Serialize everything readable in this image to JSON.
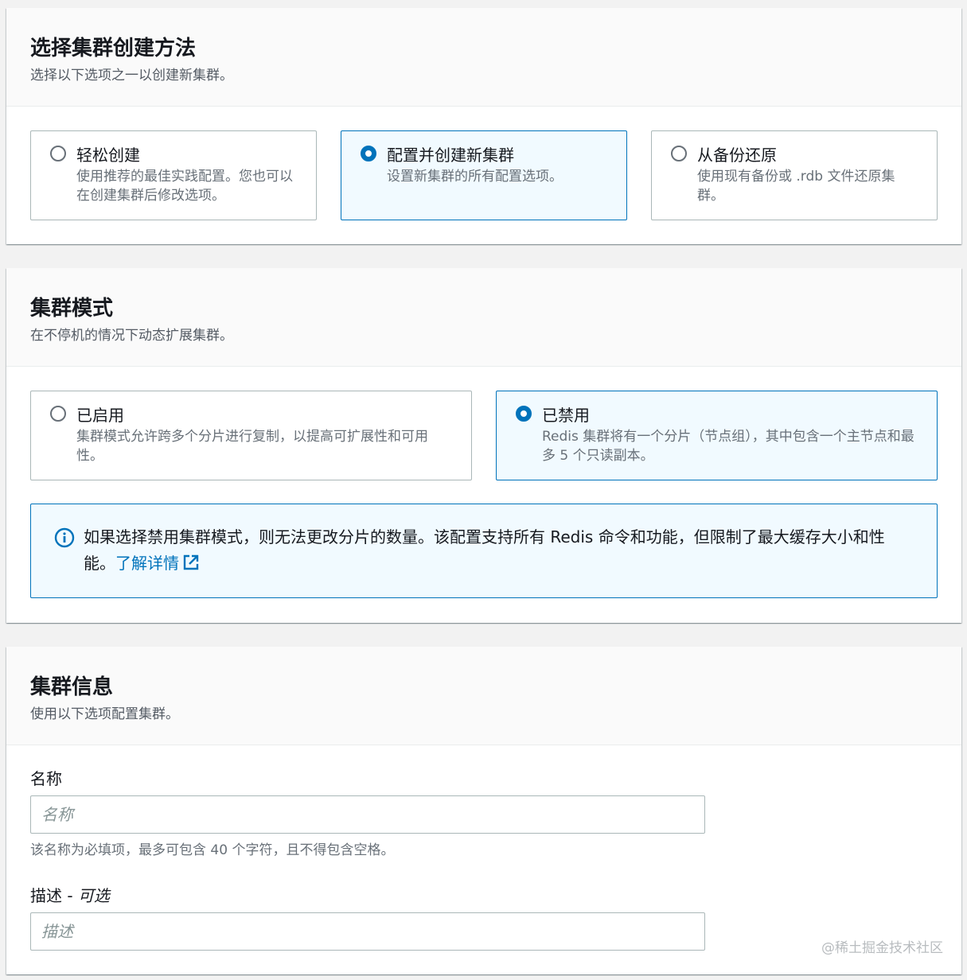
{
  "method_section": {
    "title": "选择集群创建方法",
    "description": "选择以下选项之一以创建新集群。",
    "options": [
      {
        "title": "轻松创建",
        "description": "使用推荐的最佳实践配置。您也可以在创建集群后修改选项。",
        "selected": false
      },
      {
        "title": "配置并创建新集群",
        "description": "设置新集群的所有配置选项。",
        "selected": true
      },
      {
        "title": "从备份还原",
        "description": "使用现有备份或 .rdb 文件还原集群。",
        "selected": false
      }
    ]
  },
  "mode_section": {
    "title": "集群模式",
    "description": "在不停机的情况下动态扩展集群。",
    "options": [
      {
        "title": "已启用",
        "description": "集群模式允许跨多个分片进行复制，以提高可扩展性和可用性。",
        "selected": false
      },
      {
        "title": "已禁用",
        "description": "Redis 集群将有一个分片（节点组），其中包含一个主节点和最多 5 个只读副本。",
        "selected": true
      }
    ],
    "info": {
      "text": "如果选择禁用集群模式，则无法更改分片的数量。该配置支持所有 Redis 命令和功能，但限制了最大缓存大小和性能。",
      "link_label": "了解详情",
      "icon": "info-circle-icon"
    }
  },
  "info_section": {
    "title": "集群信息",
    "description": "使用以下选项配置集群。",
    "name_field": {
      "label": "名称",
      "placeholder": "名称",
      "value": "",
      "hint": "该名称为必填项，最多可包含 40 个字符，且不得包含空格。"
    },
    "description_field": {
      "label": "描述",
      "label_suffix": "可选",
      "placeholder": "描述",
      "value": ""
    }
  },
  "watermark": "@稀土掘金技术社区",
  "colors": {
    "accent": "#0073bb",
    "selected_bg": "#f1faff",
    "border": "#aab7b8",
    "page_bg": "#f2f2f2"
  }
}
